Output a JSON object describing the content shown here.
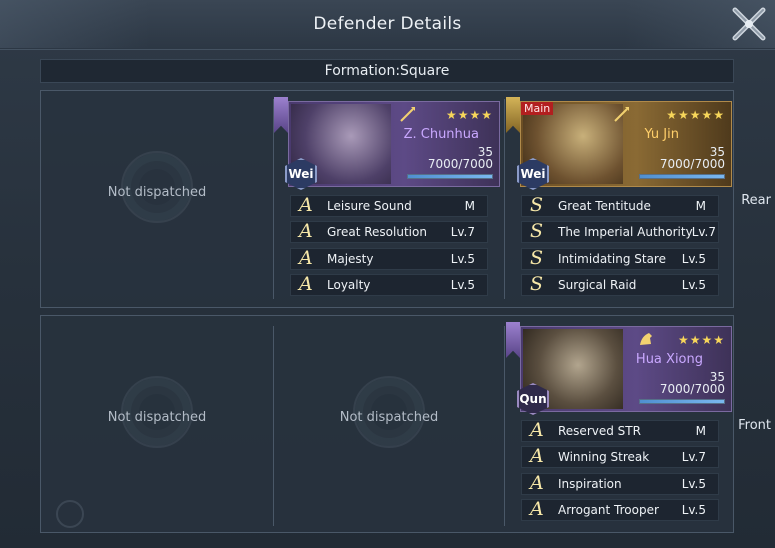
{
  "window": {
    "title": "Defender Details"
  },
  "formation": {
    "label": "Formation:Square"
  },
  "rows": {
    "rear": {
      "label": "Rear",
      "empty_text": "Not dispatched"
    },
    "front": {
      "label": "Front",
      "empty_text_1": "Not dispatched",
      "empty_text_2": "Not dispatched"
    }
  },
  "heroes": {
    "chunhua": {
      "name": "Z. Chunhua",
      "level": "35",
      "troops": "7000/7000",
      "troop_fraction": 1.0,
      "stars": "★★★★",
      "faction": "Wei",
      "skills": [
        {
          "grade": "A",
          "name": "Leisure Sound",
          "level": "M"
        },
        {
          "grade": "A",
          "name": "Great Resolution",
          "level": "Lv.7"
        },
        {
          "grade": "A",
          "name": "Majesty",
          "level": "Lv.5"
        },
        {
          "grade": "A",
          "name": "Loyalty",
          "level": "Lv.5"
        }
      ]
    },
    "yujin": {
      "name": "Yu Jin",
      "level": "35",
      "troops": "7000/7000",
      "troop_fraction": 1.0,
      "stars": "★★★★★",
      "faction": "Wei",
      "main_tag": "Main",
      "skills": [
        {
          "grade": "S",
          "name": "Great Tentitude",
          "level": "M"
        },
        {
          "grade": "S",
          "name": "The Imperial Authority",
          "level": "Lv.7"
        },
        {
          "grade": "S",
          "name": "Intimidating Stare",
          "level": "Lv.5"
        },
        {
          "grade": "S",
          "name": "Surgical Raid",
          "level": "Lv.5"
        }
      ]
    },
    "huaxiong": {
      "name": "Hua Xiong",
      "level": "35",
      "troops": "7000/7000",
      "troop_fraction": 1.0,
      "stars": "★★★★",
      "faction": "Qun",
      "skills": [
        {
          "grade": "A",
          "name": "Reserved STR",
          "level": "M"
        },
        {
          "grade": "A",
          "name": "Winning Streak",
          "level": "Lv.7"
        },
        {
          "grade": "A",
          "name": "Inspiration",
          "level": "Lv.5"
        },
        {
          "grade": "A",
          "name": "Arrogant Trooper",
          "level": "Lv.5"
        }
      ]
    }
  },
  "icons": {
    "close": "close-x-icon",
    "weapon": "spear-icon",
    "mount": "horse-icon"
  },
  "colors": {
    "purple_card": "#5d4a86",
    "gold_card": "#8a6a34",
    "star": "#f7d65a",
    "bar": "#6aa8e6"
  }
}
